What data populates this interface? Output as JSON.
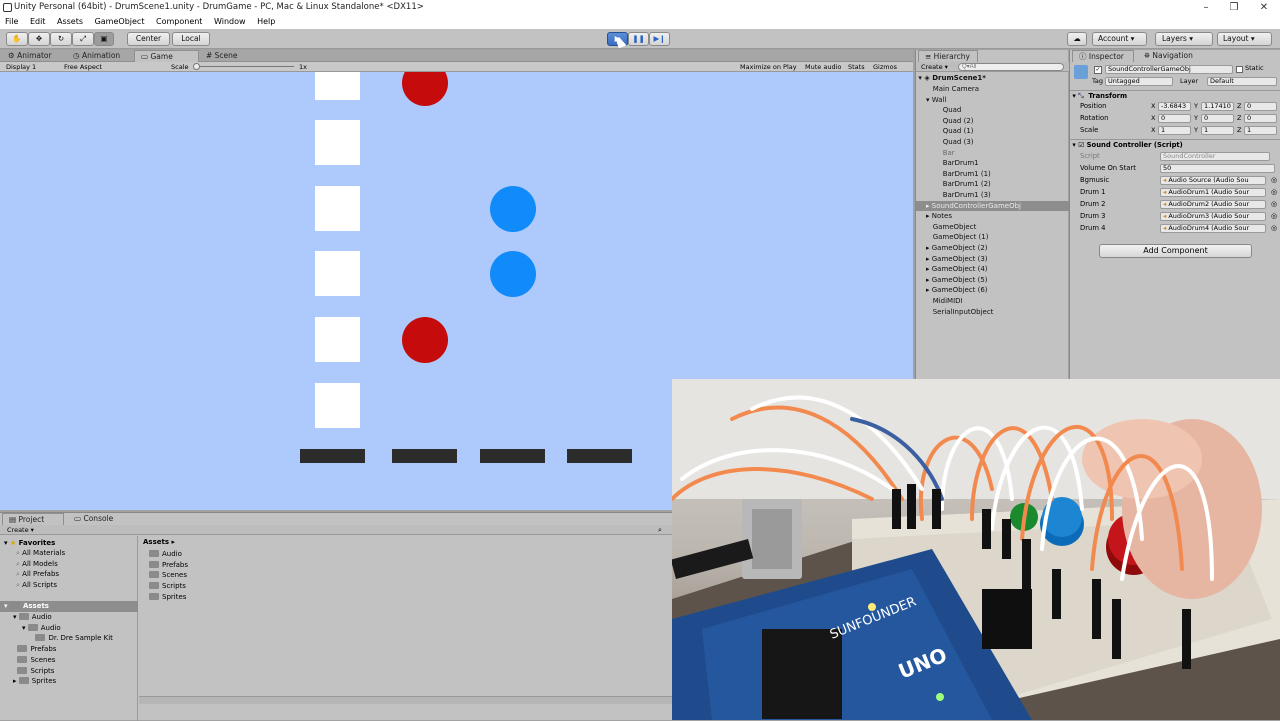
{
  "window": {
    "title": "Unity Personal (64bit) - DrumScene1.unity - DrumGame - PC, Mac & Linux Standalone* <DX11>",
    "controls": [
      "–",
      "❒",
      "✕"
    ]
  },
  "menu": [
    "File",
    "Edit",
    "Assets",
    "GameObject",
    "Component",
    "Window",
    "Help"
  ],
  "toolbar": {
    "pivot": "Center",
    "space": "Local",
    "account": "Account",
    "layers": "Layers",
    "layout": "Layout"
  },
  "center_tabs": [
    "Animator",
    "Animation",
    "Game",
    "Scene"
  ],
  "gamebar": {
    "display": "Display 1",
    "aspect": "Free Aspect",
    "scale_label": "Scale",
    "scale_value": "1x",
    "maximize": "Maximize on Play",
    "mute": "Mute audio",
    "stats": "Stats",
    "gizmos": "Gizmos"
  },
  "hierarchy": {
    "tab": "Hierarchy",
    "create": "Create",
    "search_placeholder": "Q▾All",
    "scene": "DrumScene1*",
    "items": [
      {
        "label": "Main Camera",
        "indent": 1
      },
      {
        "label": "Wall",
        "indent": 1,
        "expanded": true
      },
      {
        "label": "Quad",
        "indent": 2
      },
      {
        "label": "Quad (2)",
        "indent": 2
      },
      {
        "label": "Quad (1)",
        "indent": 2
      },
      {
        "label": "Quad (3)",
        "indent": 2
      },
      {
        "label": "Bar",
        "indent": 2,
        "dim": true
      },
      {
        "label": "BarDrum1",
        "indent": 2
      },
      {
        "label": "BarDrum1 (1)",
        "indent": 2
      },
      {
        "label": "BarDrum1 (2)",
        "indent": 2
      },
      {
        "label": "BarDrum1 (3)",
        "indent": 2
      },
      {
        "label": "SoundControllerGameObj",
        "indent": 1,
        "selected": true,
        "arrow": true
      },
      {
        "label": "Notes",
        "indent": 1,
        "arrow": true
      },
      {
        "label": "GameObject",
        "indent": 1
      },
      {
        "label": "GameObject (1)",
        "indent": 1
      },
      {
        "label": "GameObject (2)",
        "indent": 1,
        "arrow": true
      },
      {
        "label": "GameObject (3)",
        "indent": 1,
        "arrow": true
      },
      {
        "label": "GameObject (4)",
        "indent": 1,
        "arrow": true
      },
      {
        "label": "GameObject (5)",
        "indent": 1,
        "arrow": true
      },
      {
        "label": "GameObject (6)",
        "indent": 1,
        "arrow": true
      },
      {
        "label": "MidiMIDI",
        "indent": 1
      },
      {
        "label": "SerialInputObject",
        "indent": 1
      }
    ]
  },
  "inspector": {
    "tab": "Inspector",
    "tab2": "Navigation",
    "object_name": "SoundControllerGameObj",
    "static": "Static",
    "tag_label": "Tag",
    "tag_value": "Untagged",
    "layer_label": "Layer",
    "layer_value": "Default",
    "transform": {
      "title": "Transform",
      "position": {
        "label": "Position",
        "x": "-3.6843",
        "y": "1.17410",
        "z": "0"
      },
      "rotation": {
        "label": "Rotation",
        "x": "0",
        "y": "0",
        "z": "0"
      },
      "scale": {
        "label": "Scale",
        "x": "1",
        "y": "1",
        "z": "1"
      }
    },
    "script_component": {
      "title": "Sound Controller (Script)",
      "script_label": "Script",
      "script_value": "SoundController",
      "volume_label": "Volume On Start",
      "volume_value": "50",
      "fields": [
        {
          "label": "Bgmusic",
          "value": "Audio Source (Audio Sou"
        },
        {
          "label": "Drum 1",
          "value": "AudioDrum1 (Audio Sour"
        },
        {
          "label": "Drum 2",
          "value": "AudioDrum2 (Audio Sour"
        },
        {
          "label": "Drum 3",
          "value": "AudioDrum3 (Audio Sour"
        },
        {
          "label": "Drum 4",
          "value": "AudioDrum4 (Audio Sour"
        }
      ]
    },
    "add_component": "Add Component"
  },
  "project": {
    "tabs": [
      "Project",
      "Console"
    ],
    "create": "Create",
    "favorites": "Favorites",
    "favorite_items": [
      "All Materials",
      "All Models",
      "All Prefabs",
      "All Scripts"
    ],
    "assets_root": "Assets",
    "tree": [
      {
        "label": "Audio",
        "indent": 1
      },
      {
        "label": "Audio",
        "indent": 2
      },
      {
        "label": "Dr. Dre Sample Kit",
        "indent": 3
      },
      {
        "label": "Prefabs",
        "indent": 1
      },
      {
        "label": "Scenes",
        "indent": 1
      },
      {
        "label": "Scripts",
        "indent": 1
      },
      {
        "label": "Sprites",
        "indent": 1
      }
    ],
    "breadcrumb": "Assets",
    "contents": [
      "Audio",
      "Prefabs",
      "Scenes",
      "Scripts",
      "Sprites"
    ]
  },
  "game": {
    "colors": {
      "background": "#aec9fb",
      "red": "#c50b0b",
      "blue": "#118afa",
      "square": "#ffffff",
      "bar": "#2c2c2c"
    }
  }
}
